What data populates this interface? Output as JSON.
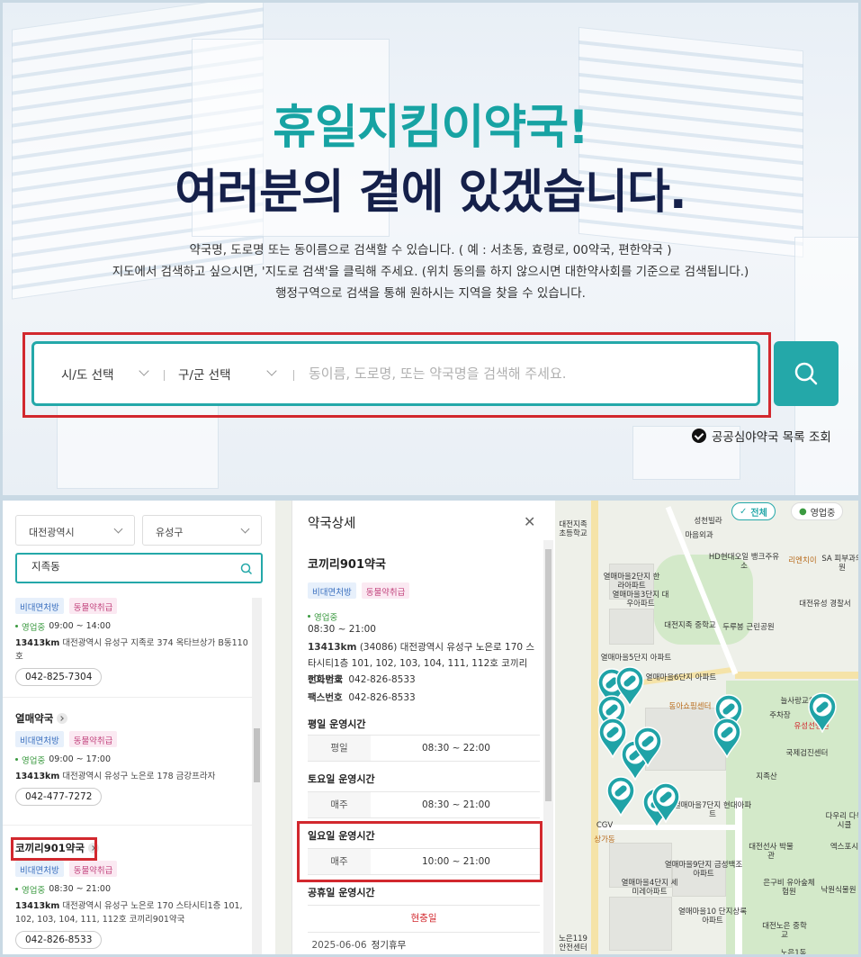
{
  "hero": {
    "title1": "휴일지킴이약국!",
    "title2": "여러분의 곁에 있겠습니다.",
    "desc": [
      "약국명, 도로명 또는 동이름으로 검색할 수 있습니다. ( 예 : 서초동, 효령로, 00약국, 편한약국 )",
      "지도에서 검색하고 싶으시면, '지도로 검색'을 클릭해 주세요. (위치 동의를 하지 않으시면 대한약사회를 기준으로 검색됩니다.)",
      "행정구역으로 검색을 통해 원하시는 지역을 찾을 수 있습니다."
    ],
    "sido_select": "시/도 선택",
    "gugun_select": "구/군 선택",
    "search_placeholder": "동이름, 도로명, 또는 약국명을 검색해 주세요.",
    "night_link": "공공심야약국 목록 조회",
    "colors": {
      "teal": "#24a8a9",
      "navy": "#15204a",
      "highlight": "#d2282e"
    }
  },
  "list": {
    "sido": "대전광역시",
    "gugun": "유성구",
    "search_value": "지족동",
    "tag_nonface": "비대면처방",
    "tag_animal": "동물약취급",
    "items": [
      {
        "name": "",
        "status": "영업중",
        "hours": "09:00 ~ 14:00",
        "distance": "13413km",
        "address": "대전광역시 유성구 지족로 374 옥타브상가 B동110호",
        "phone": "042-825-7304"
      },
      {
        "name": "열매약국",
        "status": "영업중",
        "hours": "09:00 ~ 17:00",
        "distance": "13413km",
        "address": "대전광역시 유성구 노은로 178 금강프라자",
        "phone": "042-477-7272"
      },
      {
        "name": "코끼리901약국",
        "status": "영업중",
        "hours": "08:30 ~ 21:00",
        "distance": "13413km",
        "address": "대전광역시 유성구 노은로 170 스타시티1층 101, 102, 103, 104, 111, 112호 코끼리901약국",
        "phone": "042-826-8533"
      }
    ]
  },
  "detail": {
    "heading": "약국상세",
    "name": "코끼리901약국",
    "tags": [
      "비대면처방",
      "동물약취급"
    ],
    "status": "영업중",
    "hours": "08:30 ~ 21:00",
    "distance": "13413km",
    "address": "(34086) 대전광역시 유성구 노은로 170 스타시티1층 101, 102, 103, 104, 111, 112호 코끼리901약국",
    "phone_label": "전화번호",
    "phone": "042-826-8533",
    "fax_label": "팩스번호",
    "fax": "042-826-8533",
    "weekday_title": "평일 운영시간",
    "weekday_day": "평일",
    "weekday_time": "08:30 ~ 22:00",
    "sat_title": "토요일 운영시간",
    "sat_day": "매주",
    "sat_time": "08:30 ~ 21:00",
    "sun_title": "일요일 운영시간",
    "sun_day": "매주",
    "sun_time": "10:00 ~ 21:00",
    "holiday_title": "공휴일 운영시간",
    "holiday_status": "현충일",
    "holiday_date": "2025-06-06",
    "holiday_note": "정기휴무"
  },
  "map": {
    "filter_all": "전체",
    "filter_open": "영업중",
    "labels": [
      "대전지족 초등학교",
      "성천빌라",
      "마음외과",
      "열매마을2단지 한라아파트",
      "열매마을3단지 대우아파트",
      "HD현대오일 뱅크주유소",
      "리엔치이",
      "SA 피부과의원",
      "대전유성 경찰서",
      "대전지족 중학교",
      "두루봉 근린공원",
      "열매마을5단지 아파트",
      "열매마을6단지 아파트",
      "동아쇼핑센터",
      "늘사랑교회",
      "주차장",
      "유성선병원",
      "국제검진센터",
      "지족산",
      "CGV",
      "상가동",
      "열매마을7단지 현대아파트",
      "대전선사 박물관",
      "다우리 다욱시클",
      "엑스포시",
      "열매마을9단지 금성백조아파트",
      "은구비 유아숲체험원",
      "낙원식물원",
      "열매마을10 단지상록아파트",
      "대전노은 중학교",
      "노은119 안전센터",
      "노은1동",
      "열매마을4단지 세미레아파트"
    ]
  }
}
